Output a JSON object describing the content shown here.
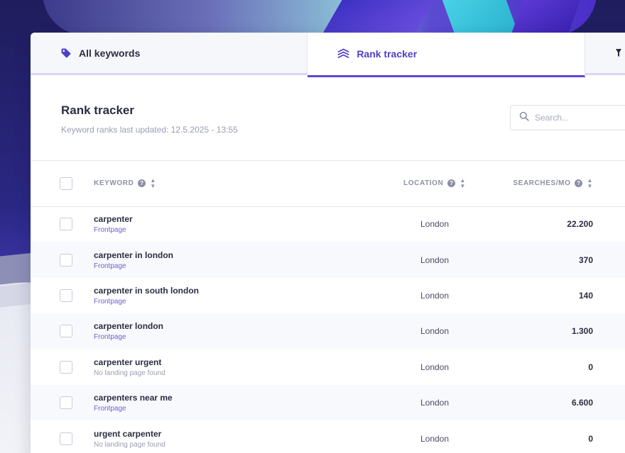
{
  "tabs": [
    {
      "label": "All keywords",
      "icon": "tag-icon",
      "active": false
    },
    {
      "label": "Rank tracker",
      "icon": "layers-icon",
      "active": true
    }
  ],
  "header": {
    "title": "Rank tracker",
    "subtitle": "Keyword ranks last updated: 12.5.2025 - 13:55"
  },
  "search": {
    "placeholder": "Search..."
  },
  "table": {
    "columns": {
      "keyword": "KEYWORD",
      "location": "LOCATION",
      "searches": "SEARCHES/MO"
    },
    "rows": [
      {
        "keyword": "carpenter",
        "landing": "Frontpage",
        "location": "London",
        "searches": "22.200"
      },
      {
        "keyword": "carpenter in london",
        "landing": "Frontpage",
        "location": "London",
        "searches": "370"
      },
      {
        "keyword": "carpenter in south london",
        "landing": "Frontpage",
        "location": "London",
        "searches": "140"
      },
      {
        "keyword": "carpenter london",
        "landing": "Frontpage",
        "location": "London",
        "searches": "1.300"
      },
      {
        "keyword": "carpenter urgent",
        "landing": "No landing page found",
        "location": "London",
        "searches": "0"
      },
      {
        "keyword": "carpenters near me",
        "landing": "Frontpage",
        "location": "London",
        "searches": "6.600"
      },
      {
        "keyword": "urgent carpenter",
        "landing": "No landing page found",
        "location": "London",
        "searches": "0"
      }
    ]
  },
  "colors": {
    "accent": "#5b47d6",
    "text": "#2b2d42",
    "muted": "#9a9db2"
  }
}
